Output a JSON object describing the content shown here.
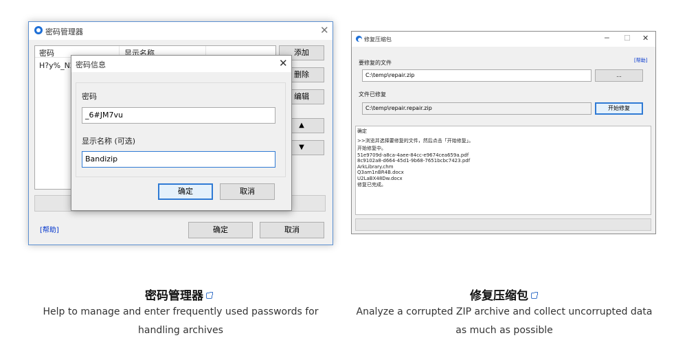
{
  "password_manager": {
    "title": "密码管理器",
    "columns": [
      "密码",
      "显示名称"
    ],
    "row_password": "H?y%_N2",
    "buttons": {
      "add": "添加",
      "delete": "删除",
      "edit": "编辑",
      "up": "▲",
      "down": "▼",
      "ok": "确定",
      "cancel": "取消"
    },
    "help": "[帮助]"
  },
  "password_dialog": {
    "title": "密码信息",
    "password_label": "密码",
    "password_value": "_6#JM7vu",
    "name_label": "显示名称 (可选)",
    "name_value": "Bandizip",
    "ok": "确定",
    "cancel": "取消"
  },
  "repair_window": {
    "title": "修复压缩包",
    "help": "[帮助]",
    "source_label": "要修复的文件",
    "source_value": "C:\\temp\\repair.zip",
    "browse": "...",
    "output_label": "文件已修复",
    "output_value": "C:\\temp\\repair.repair.zip",
    "start": "开始修复",
    "log": [
      "确定",
      ">>浏览并选择要修复的文件，然后点击「开始修复」。",
      "开始修复中。",
      "51e9709d-a8ca-4aee-84cc-e9674cea659a.pdf",
      "8c9102a8-d664-45d1-9b68-7651bcbc7423.pdf",
      "ArkLibrary.chm",
      "Q3am1nBR4B.docx",
      "U2LaBX48Dw.docx",
      "修复已完成。"
    ]
  },
  "captions": {
    "left_title": "密码管理器",
    "left_desc": "Help to manage and enter frequently used passwords for handling archives",
    "right_title": "修复压缩包",
    "right_desc": "Analyze a corrupted ZIP archive and collect uncorrupted data as much as possible"
  }
}
